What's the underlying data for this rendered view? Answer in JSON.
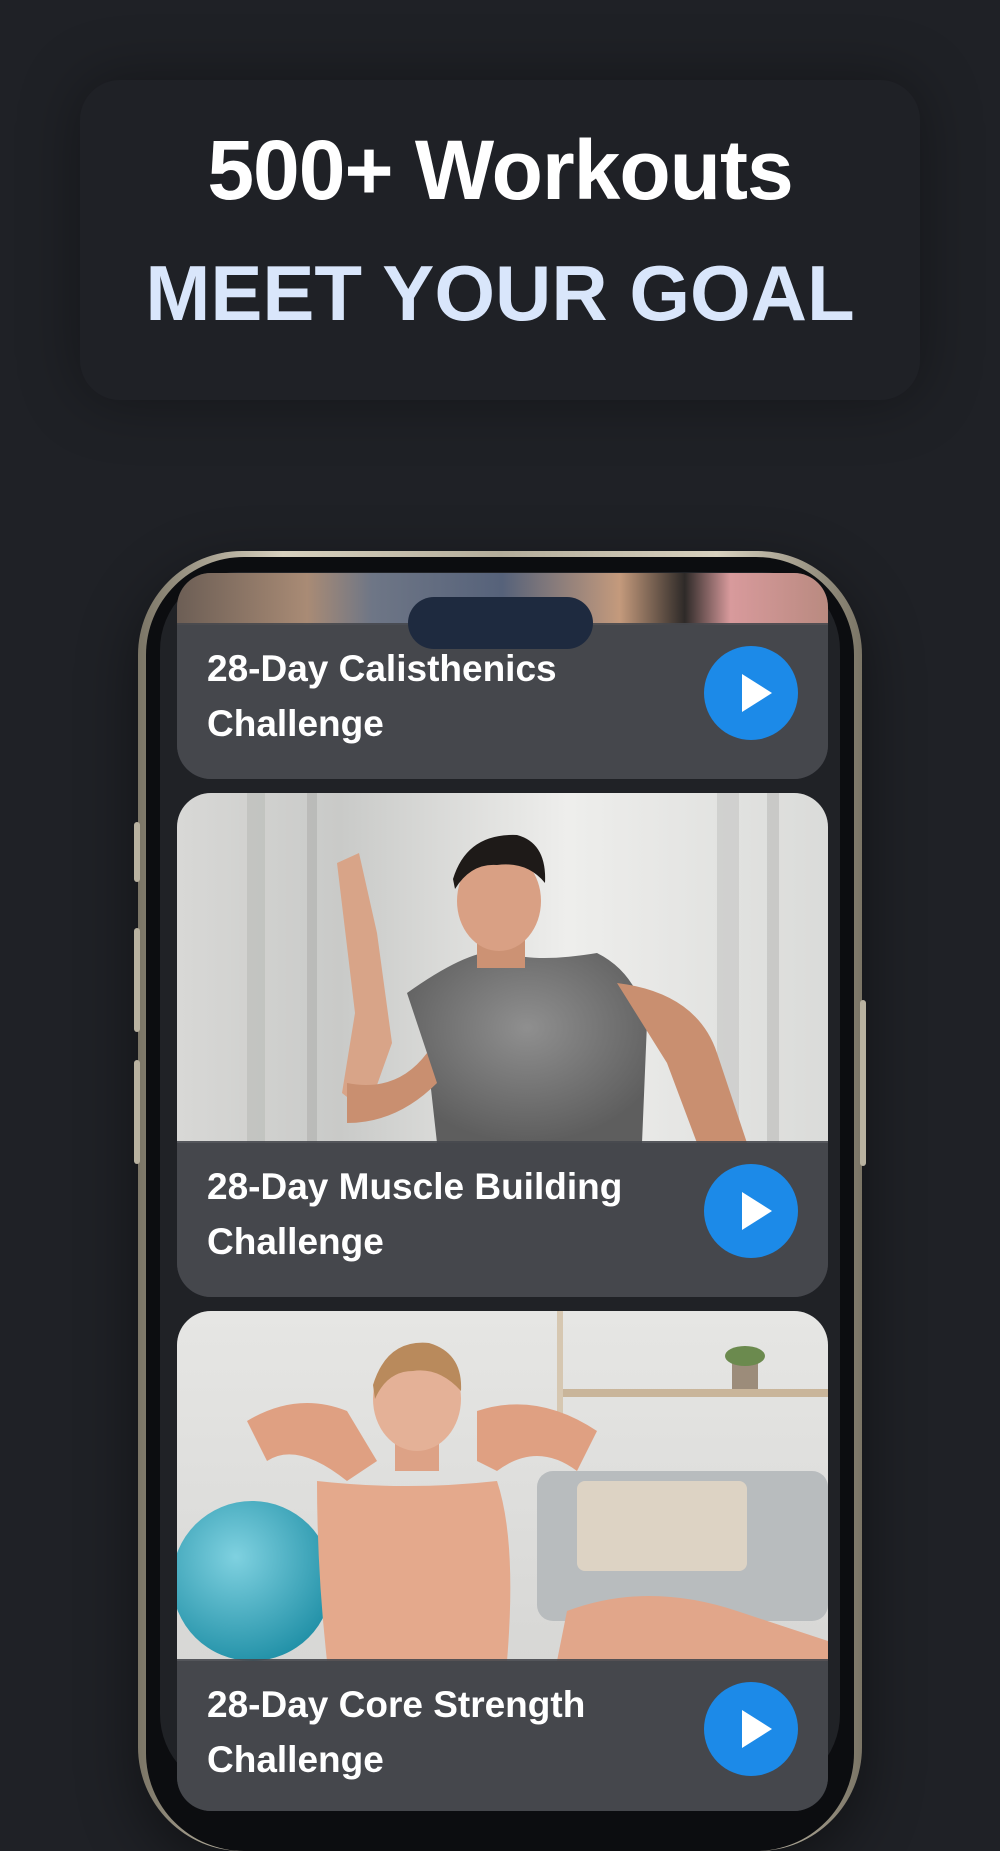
{
  "header": {
    "title": "500+ Workouts",
    "subtitle": "MEET YOUR GOAL"
  },
  "workouts": [
    {
      "title": "28-Day Calisthenics Challenge",
      "play_icon": "play-icon"
    },
    {
      "title": "28-Day Muscle Building Challenge",
      "play_icon": "play-icon"
    },
    {
      "title": "28-Day Core Strength Challenge",
      "play_icon": "play-icon"
    }
  ],
  "colors": {
    "background": "#1f2126",
    "accent_blue": "#1c8ae8",
    "subtitle_blue": "#d9e6fb",
    "card_footer": "#46484e"
  }
}
